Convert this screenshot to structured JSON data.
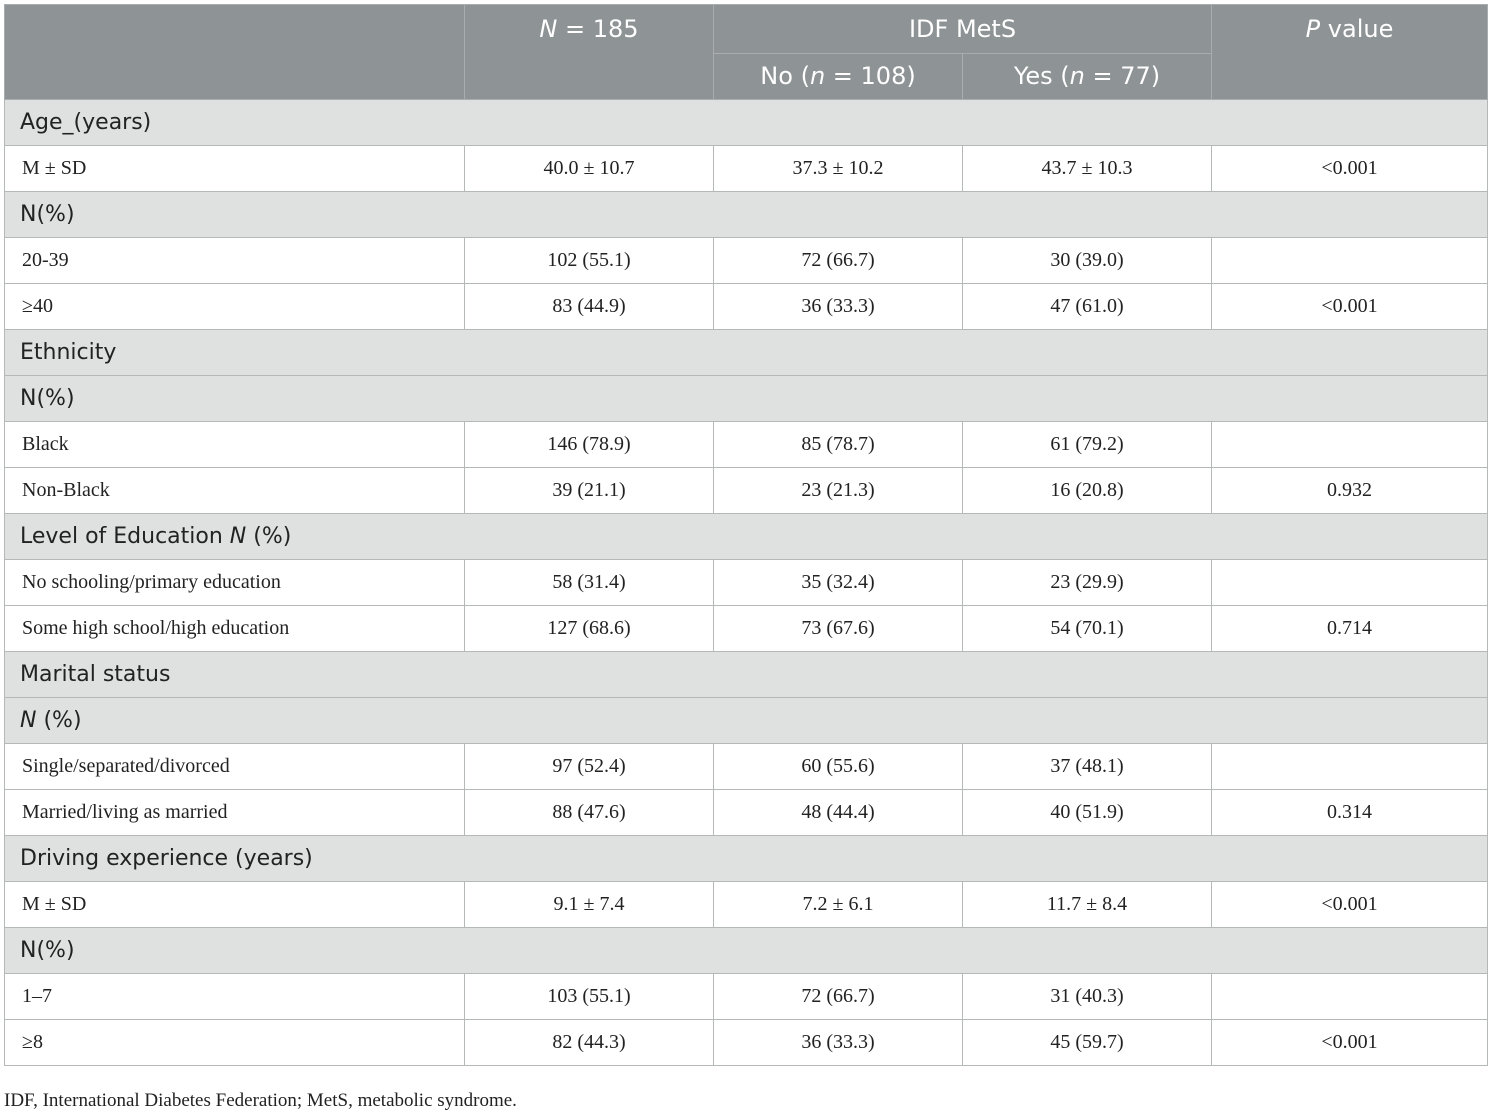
{
  "header": {
    "total": {
      "prefix": "N",
      "suffix": " = 185"
    },
    "group": "IDF MetS",
    "no": {
      "a": "No (",
      "n": "n",
      "b": " = 108)"
    },
    "yes": {
      "a": "Yes (",
      "n": "n",
      "b": " = 77)"
    },
    "pvalue": {
      "p": "P",
      "rest": " value"
    }
  },
  "sections": {
    "age": "Age_(years)",
    "age_npct": "N(%)",
    "ethnicity": "Ethnicity",
    "ethnicity_npct": "N(%)",
    "education": {
      "text": "Level of Education ",
      "n": "N",
      "pct": " (%)"
    },
    "marital": "Marital status",
    "marital_npct": {
      "n": "N",
      "pct": " (%)"
    },
    "driving": "Driving experience (years)",
    "driving_npct": "N(%)"
  },
  "rows": {
    "age_msd": [
      "M ± SD",
      "40.0 ± 10.7",
      "37.3 ± 10.2",
      "43.7 ± 10.3",
      "<0.001"
    ],
    "age_20_39": [
      "20-39",
      "102 (55.1)",
      "72 (66.7)",
      "30 (39.0)",
      ""
    ],
    "age_40": [
      "≥40",
      "83 (44.9)",
      "36 (33.3)",
      "47 (61.0)",
      "<0.001"
    ],
    "eth_black": [
      "Black",
      "146 (78.9)",
      "85 (78.7)",
      "61 (79.2)",
      ""
    ],
    "eth_nonblack": [
      "Non-Black",
      "39 (21.1)",
      "23 (21.3)",
      "16 (20.8)",
      "0.932"
    ],
    "edu_primary": [
      "No schooling/primary education",
      "58 (31.4)",
      "35 (32.4)",
      "23 (29.9)",
      ""
    ],
    "edu_high": [
      "Some high school/high education",
      "127 (68.6)",
      "73 (67.6)",
      "54 (70.1)",
      "0.714"
    ],
    "mar_single": [
      "Single/separated/divorced",
      "97 (52.4)",
      "60 (55.6)",
      "37 (48.1)",
      ""
    ],
    "mar_married": [
      "Married/living as married",
      "88 (47.6)",
      "48 (44.4)",
      "40 (51.9)",
      "0.314"
    ],
    "drv_msd": [
      "M ± SD",
      "9.1 ± 7.4",
      "7.2 ± 6.1",
      "11.7 ± 8.4",
      "<0.001"
    ],
    "drv_1_7": [
      "1–7",
      "103 (55.1)",
      "72 (66.7)",
      "31 (40.3)",
      ""
    ],
    "drv_8": [
      "≥8",
      "82 (44.3)",
      "36 (33.3)",
      "45 (59.7)",
      "<0.001"
    ]
  },
  "footnote": "IDF, International Diabetes Federation; MetS, metabolic syndrome."
}
